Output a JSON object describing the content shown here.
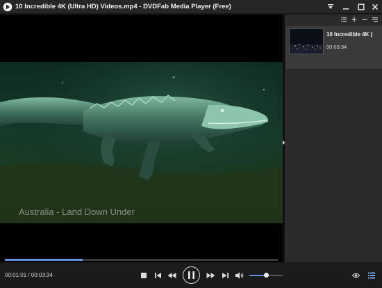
{
  "window": {
    "title": "10 Incredible 4K (Ultra HD) Videos.mp4 - DVDFab Media Player (Free)"
  },
  "video": {
    "subtitle": "Australia - Land Down Under"
  },
  "playlist": {
    "items": [
      {
        "name": "10 Incredible 4K (",
        "duration": "00:03:34"
      }
    ]
  },
  "playback": {
    "time_display": "00:01:01 / 00:03:34",
    "progress_fraction": 0.285,
    "volume_fraction": 0.5
  },
  "colors": {
    "accent": "#5e8fd8",
    "background": "#1b1b1b",
    "panel": "#2a2a2a"
  }
}
